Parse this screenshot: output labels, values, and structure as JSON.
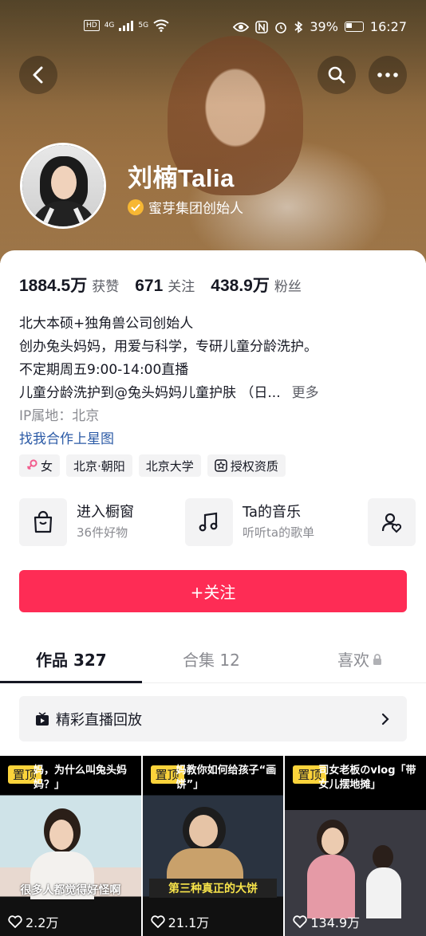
{
  "status_bar": {
    "network_chip": "HD",
    "network_gen": "4G",
    "network_gen2": "5G",
    "battery": "39%",
    "time": "16:27"
  },
  "profile": {
    "name": "刘楠Talia",
    "verified_title": "蜜芽集团创始人"
  },
  "stats": [
    {
      "value": "1884.5万",
      "label": "获赞"
    },
    {
      "value": "671",
      "label": "关注"
    },
    {
      "value": "438.9万",
      "label": "粉丝"
    }
  ],
  "bio": {
    "line1": "北大本硕+独角兽公司创始人",
    "line2": "创办兔头妈妈，用爱与科学，专研儿童分龄洗护。",
    "line3": "不定期周五9:00-14:00直播",
    "line4": "儿童分龄洗护到@兔头妈妈儿童护肤 （日...",
    "more": "更多",
    "ip": "IP属地：北京",
    "link": "找我合作上星图"
  },
  "tags": {
    "gender": "女",
    "location": "北京·朝阳",
    "school": "北京大学",
    "auth": "授权资质"
  },
  "services": {
    "shop_title": "进入橱窗",
    "shop_sub": "36件好物",
    "music_title": "Ta的音乐",
    "music_sub": "听听ta的歌单"
  },
  "follow_button": "+关注",
  "tabs": [
    {
      "label": "作品 327",
      "active": true
    },
    {
      "label": "合集 12",
      "active": false
    },
    {
      "label": "喜欢",
      "active": false
    }
  ],
  "replay_label": "精彩直播回放",
  "videos": [
    {
      "pin": "置顶",
      "caption": "妈，为什么叫兔头妈妈？」",
      "subtitle": "很多人都觉得好怪啊",
      "likes": "2.2万"
    },
    {
      "pin": "置顶",
      "caption": "妈教你如何给孩子“画饼”」",
      "subtitle": "第三种真正的大饼",
      "likes": "21.1万"
    },
    {
      "pin": "置顶",
      "caption": "司女老板のvlog「带女儿摆地摊」",
      "subtitle": "",
      "likes": "134.9万"
    }
  ],
  "colors": {
    "follow_red": "#fe2c55",
    "pin_yellow": "#fbd33b",
    "verify_gold": "#f7b733",
    "link_blue": "#2b5aa6"
  }
}
